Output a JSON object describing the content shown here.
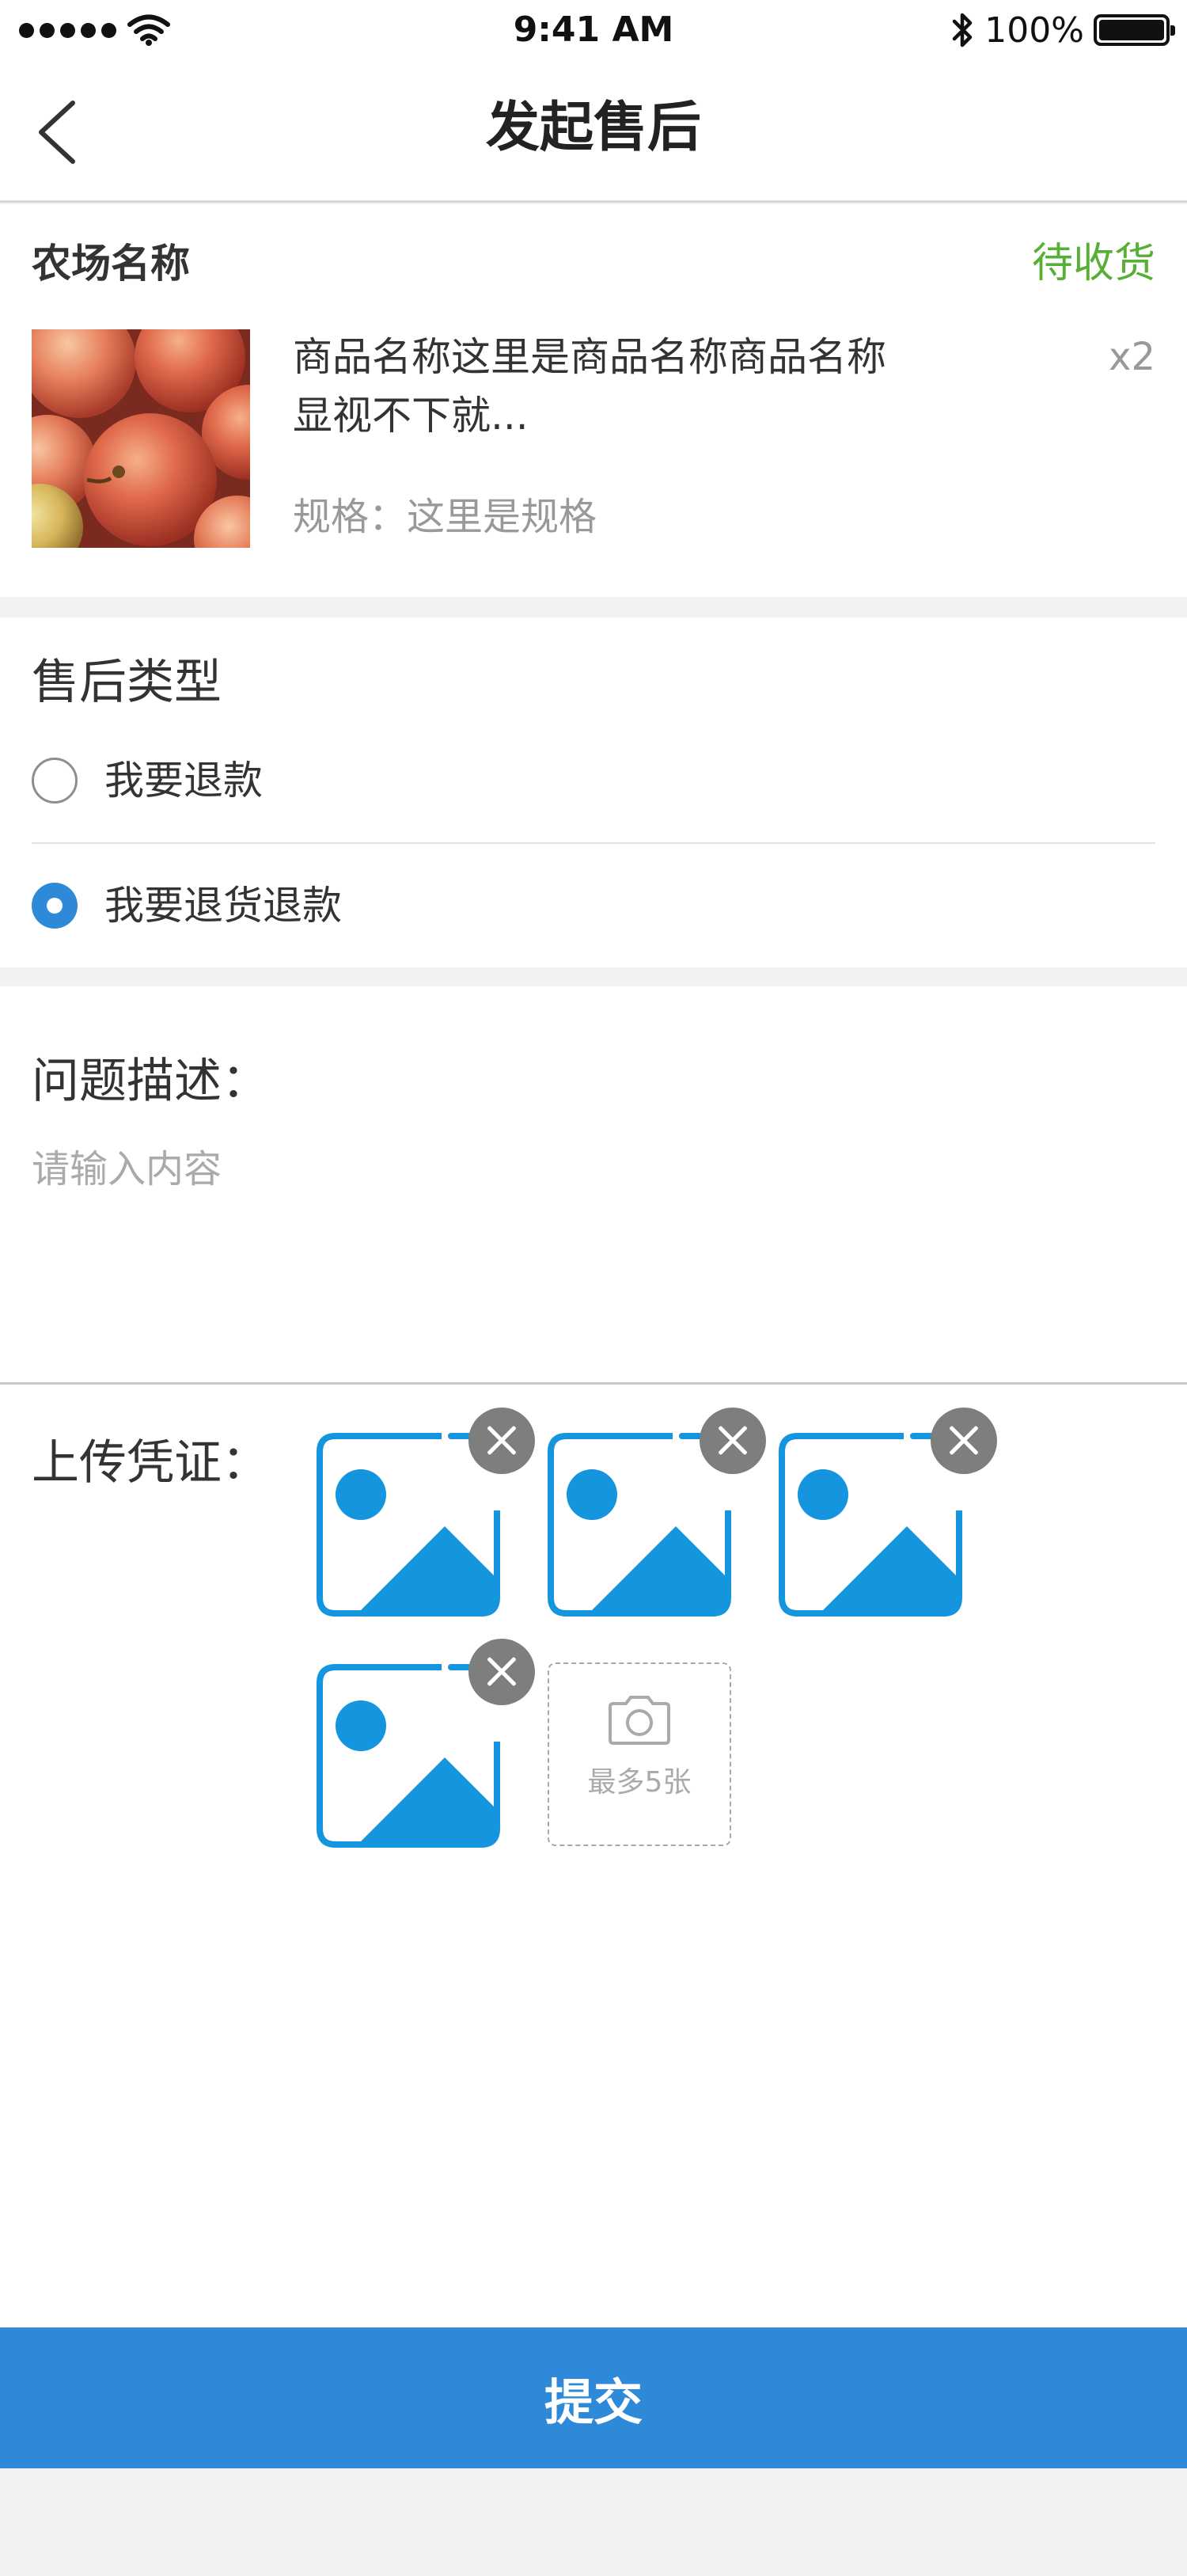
{
  "status_bar": {
    "time": "9:41 AM",
    "battery": "100%"
  },
  "nav": {
    "title": "发起售后"
  },
  "order": {
    "farm_name": "农场名称",
    "status": "待收货",
    "status_color": "#56b036",
    "product_name": "商品名称这里是商品名称商品名称显视不下就...",
    "quantity": "x2",
    "spec": "规格：这里是规格"
  },
  "after_sales_type": {
    "label": "售后类型",
    "options": [
      {
        "label": "我要退款",
        "selected": false
      },
      {
        "label": "我要退货退款",
        "selected": true
      }
    ]
  },
  "description": {
    "label": "问题描述：",
    "placeholder": "请输入内容",
    "value": ""
  },
  "upload": {
    "label": "上传凭证：",
    "photo_count": 4,
    "photo_icon": "image-placeholder-icon",
    "remove_icon": "close-icon",
    "add_icon": "camera-icon",
    "add_hint": "最多5张"
  },
  "submit": {
    "label": "提交"
  },
  "colors": {
    "accent": "#2e8ad8",
    "image_blue": "#1595de"
  }
}
